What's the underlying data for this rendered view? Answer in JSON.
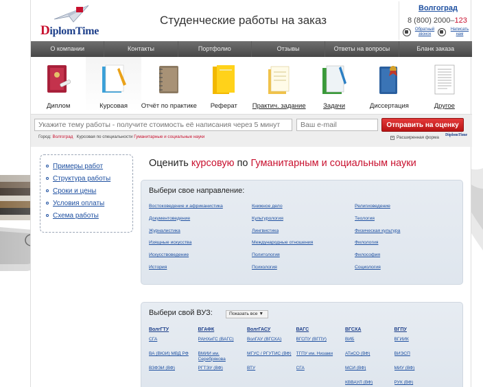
{
  "header": {
    "logo_letter": "D",
    "logo_text": "iplomTime",
    "title": "Студенческие работы на заказ",
    "city": "Волгоград",
    "phone_main": "8 (800) 2000–",
    "phone_accent": "123",
    "callback_label": "Обратный звонок",
    "write_label": "Написать нам"
  },
  "nav": [
    "О компании",
    "Контакты",
    "Портфолио",
    "Отзывы",
    "Ответы на вопросы",
    "Бланк заказа"
  ],
  "categories": [
    {
      "label": "Диплом",
      "icon": "diploma-book-icon"
    },
    {
      "label": "Курсовая",
      "icon": "coursework-folder-icon"
    },
    {
      "label": "Отчёт по практике",
      "icon": "notebook-icon"
    },
    {
      "label": "Реферат",
      "icon": "yellow-folder-icon"
    },
    {
      "label": "Практич. задание",
      "icon": "papers-icon"
    },
    {
      "label": "Задачи",
      "icon": "green-folder-icon"
    },
    {
      "label": "Диссертация",
      "icon": "dissertation-book-icon"
    },
    {
      "label": "Другое",
      "icon": "document-icon"
    }
  ],
  "search": {
    "topic_placeholder": "Укажите тему работы - получите стоимость её написания через 5 минут",
    "email_placeholder": "Ваш e-mail",
    "submit_label": "Отправить на оценку",
    "crumb_city_label": "Город:",
    "crumb_city": "Волгоград",
    "crumb_type": "Курсовая",
    "crumb_spec_label": "по специальности",
    "crumb_spec": "Гуманитарные и социальные науки",
    "extended_form": "Расширенная форма",
    "mini_logo": "DiplomTime"
  },
  "side_menu": [
    "Примеры работ",
    "Структура работы",
    "Сроки и цены",
    "Условия оплаты",
    "Схема работы"
  ],
  "heading": {
    "part1": "Оценить ",
    "part2": "курсовую",
    "part3": " по ",
    "part4": "Гуманитарным и социальным науки"
  },
  "directions": {
    "title": "Выбери свое направление:",
    "columns": [
      [
        "Востоковедение и африканистика",
        "Документоведение",
        "Журналистика",
        "Изящные искусства",
        "Искусствоведение",
        "История"
      ],
      [
        "Книжное дело",
        "Культурология",
        "Лингвистика",
        "Международные отношения",
        "Политология",
        "Психология"
      ],
      [
        "Религиоведение",
        "Теология",
        "Физическая культура",
        "Филология",
        "Философия",
        "Социология"
      ]
    ]
  },
  "vuz": {
    "title": "Выбери свой ВУЗ:",
    "show_all": "Показать все ▼",
    "columns": [
      {
        "head": "ВолгГТУ",
        "items": [
          "СГА",
          "ВА (ВЮИ) МВД РФ",
          "ВЗФЭИ (ВФ)"
        ]
      },
      {
        "head": "ВГАФК",
        "items": [
          "РАНХиГС (ВАГС)",
          "ВМИИ им. Серебрякова",
          "РГТЭУ (ВФ)"
        ]
      },
      {
        "head": "ВолгГАСУ",
        "items": [
          "ВолГАУ (ВГСХА)",
          "МГУС / РГУТИС (ВФ)",
          "ВТУ"
        ]
      },
      {
        "head": "ВАГС",
        "items": [
          "ВГСПУ (ВГПУ)",
          "ТГПУ им. Низами",
          "СГА"
        ]
      },
      {
        "head": "ВГСХА",
        "items": [
          "ВИБ",
          "АТиСО (ВФ)",
          "МСИ (ВФ)",
          "КВВАУЛ (ВФ)"
        ]
      },
      {
        "head": "ВГПУ",
        "items": [
          "ВГИИК",
          "ВИЭСП",
          "МИУ (ВФ)",
          "РУК (ВФ)"
        ]
      }
    ]
  },
  "colors": {
    "brand_blue": "#1d4fa0",
    "accent_red": "#c8102e",
    "nav_dark": "#474747",
    "panel_bg": "#e7ecf2"
  }
}
